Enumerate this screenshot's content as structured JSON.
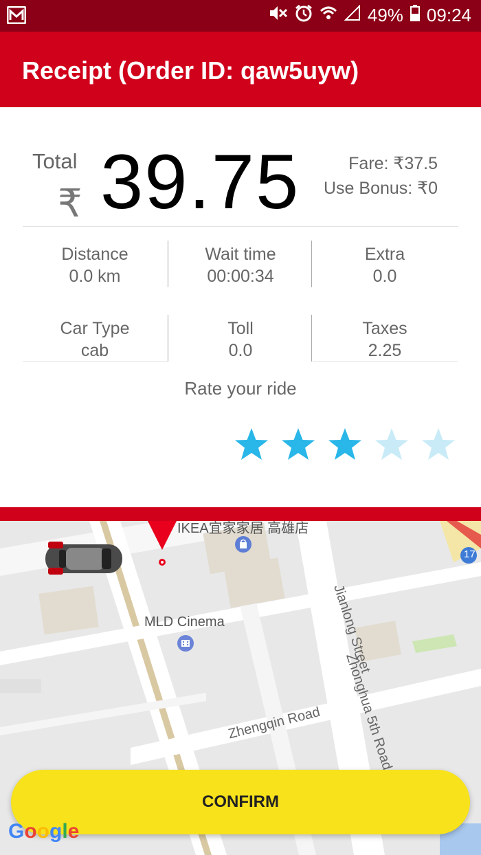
{
  "status_bar": {
    "battery": "49%",
    "time": "09:24",
    "icons": [
      "mail-icon",
      "mute-icon",
      "alarm-icon",
      "wifi-icon",
      "signal-icon",
      "battery-icon"
    ]
  },
  "header": {
    "title": "Receipt (Order ID: qaw5uyw)",
    "color": "#d0011b"
  },
  "total": {
    "label": "Total",
    "currency_symbol": "₹",
    "amount": "39.75",
    "fare": "Fare: ₹37.5",
    "bonus": "Use Bonus: ₹0"
  },
  "details": [
    {
      "label": "Distance",
      "value": "0.0 km"
    },
    {
      "label": "Wait time",
      "value": "00:00:34"
    },
    {
      "label": "Extra",
      "value": "0.0"
    },
    {
      "label": "Car Type",
      "value": "cab"
    },
    {
      "label": "Toll",
      "value": "0.0"
    },
    {
      "label": "Taxes",
      "value": "2.25"
    }
  ],
  "rating": {
    "label": "Rate your ride",
    "value": 3,
    "max": 5,
    "filled_color": "#29b6e8",
    "empty_color": "#c8ebf7"
  },
  "map": {
    "labels": {
      "ikea": "IKEA宜家家居 高雄店",
      "cinema": "MLD Cinema",
      "jianlong": "Jianlong Street",
      "zhonghua": "Zhonghua 5th Road",
      "zhengqin": "Zhengqin Road",
      "road_number": "17"
    },
    "attribution": "Google"
  },
  "confirm_label": "CONFIRM"
}
